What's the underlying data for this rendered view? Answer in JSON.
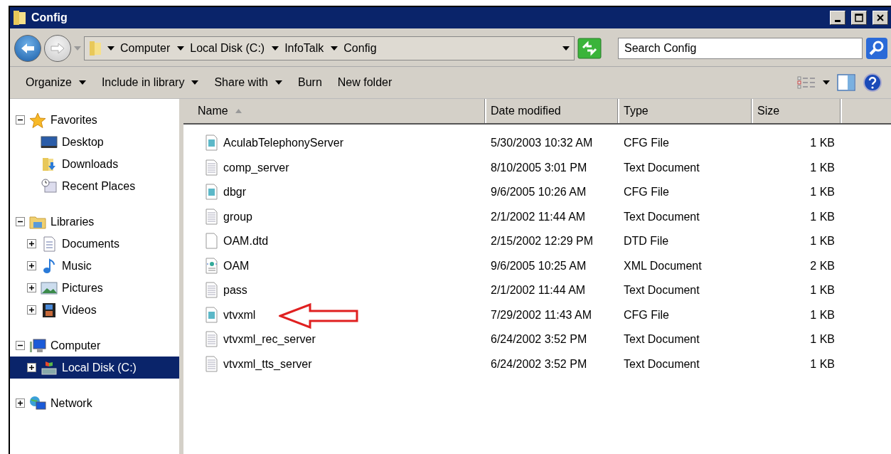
{
  "window": {
    "title": "Config"
  },
  "address": {
    "crumbs": [
      "Computer",
      "Local Disk (C:)",
      "InfoTalk",
      "Config"
    ]
  },
  "search": {
    "placeholder": "Search Config"
  },
  "toolbar": [
    {
      "label": "Organize",
      "menu": true
    },
    {
      "label": "Include in library",
      "menu": true
    },
    {
      "label": "Share with",
      "menu": true
    },
    {
      "label": "Burn",
      "menu": false
    },
    {
      "label": "New folder",
      "menu": false
    }
  ],
  "sidebar": {
    "groups": [
      {
        "label": "Favorites",
        "kind": "star",
        "expanded": true,
        "selected": false,
        "children": [
          {
            "label": "Desktop",
            "kind": "desktop",
            "selected": false
          },
          {
            "label": "Downloads",
            "kind": "downloads",
            "selected": false
          },
          {
            "label": "Recent Places",
            "kind": "recent",
            "selected": false
          }
        ]
      },
      {
        "label": "Libraries",
        "kind": "library",
        "expanded": true,
        "selected": false,
        "children": [
          {
            "label": "Documents",
            "kind": "documents",
            "expanded": false,
            "selected": false
          },
          {
            "label": "Music",
            "kind": "music",
            "expanded": false,
            "selected": false
          },
          {
            "label": "Pictures",
            "kind": "pictures",
            "expanded": false,
            "selected": false
          },
          {
            "label": "Videos",
            "kind": "videos",
            "expanded": false,
            "selected": false
          }
        ]
      },
      {
        "label": "Computer",
        "kind": "computer",
        "expanded": true,
        "selected": false,
        "children": [
          {
            "label": "Local Disk (C:)",
            "kind": "disk",
            "expanded": false,
            "selected": true
          }
        ]
      },
      {
        "label": "Network",
        "kind": "network",
        "expanded": false,
        "selected": false
      }
    ]
  },
  "table": {
    "columns": [
      "Name",
      "Date modified",
      "Type",
      "Size"
    ],
    "rows": [
      {
        "name": "AculabTelephonyServer",
        "date": "5/30/2003 10:32 AM",
        "type": "CFG File",
        "size": "1 KB",
        "kind": "cfg",
        "annotated": false
      },
      {
        "name": "comp_server",
        "date": "8/10/2005 3:01 PM",
        "type": "Text Document",
        "size": "1 KB",
        "kind": "text",
        "annotated": false
      },
      {
        "name": "dbgr",
        "date": "9/6/2005 10:26 AM",
        "type": "CFG File",
        "size": "1 KB",
        "kind": "cfg",
        "annotated": false
      },
      {
        "name": "group",
        "date": "2/1/2002 11:44 AM",
        "type": "Text Document",
        "size": "1 KB",
        "kind": "text",
        "annotated": false
      },
      {
        "name": "OAM.dtd",
        "date": "2/15/2002 12:29 PM",
        "type": "DTD File",
        "size": "1 KB",
        "kind": "blank",
        "annotated": false
      },
      {
        "name": "OAM",
        "date": "9/6/2005 10:25 AM",
        "type": "XML Document",
        "size": "2 KB",
        "kind": "xml",
        "annotated": false
      },
      {
        "name": "pass",
        "date": "2/1/2002 11:44 AM",
        "type": "Text Document",
        "size": "1 KB",
        "kind": "text",
        "annotated": false
      },
      {
        "name": "vtvxml",
        "date": "7/29/2002 11:43 AM",
        "type": "CFG File",
        "size": "1 KB",
        "kind": "cfg",
        "annotated": true
      },
      {
        "name": "vtvxml_rec_server",
        "date": "6/24/2002 3:52 PM",
        "type": "Text Document",
        "size": "1 KB",
        "kind": "text",
        "annotated": false
      },
      {
        "name": "vtvxml_tts_server",
        "date": "6/24/2002 3:52 PM",
        "type": "Text Document",
        "size": "1 KB",
        "kind": "text",
        "annotated": false
      }
    ]
  }
}
